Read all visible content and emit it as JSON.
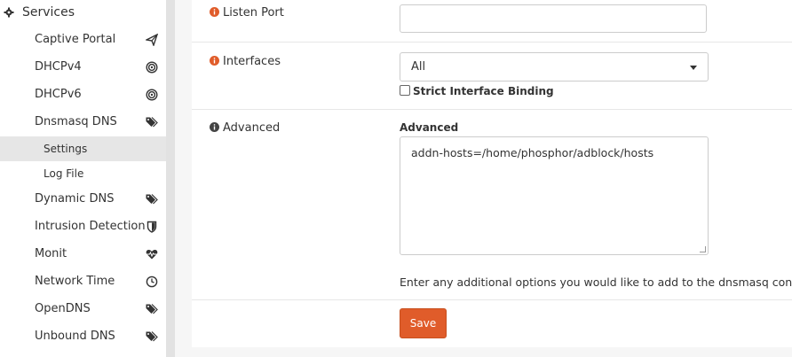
{
  "sidebar": {
    "header_label": "Services",
    "items": [
      {
        "label": "Captive Portal",
        "icon": "paper-plane-icon"
      },
      {
        "label": "DHCPv4",
        "icon": "bullseye-icon"
      },
      {
        "label": "DHCPv6",
        "icon": "bullseye-icon"
      },
      {
        "label": "Dnsmasq DNS",
        "icon": "tags-icon"
      },
      {
        "label": "Dynamic DNS",
        "icon": "tags-icon"
      },
      {
        "label": "Intrusion Detection",
        "icon": "shield-icon"
      },
      {
        "label": "Monit",
        "icon": "heartbeat-icon"
      },
      {
        "label": "Network Time",
        "icon": "clock-icon"
      },
      {
        "label": "OpenDNS",
        "icon": "tags-icon"
      },
      {
        "label": "Unbound DNS",
        "icon": "tags-icon"
      }
    ],
    "subitems": [
      {
        "label": "Settings",
        "active": true
      },
      {
        "label": "Log File",
        "active": false
      }
    ]
  },
  "form": {
    "listen_port": {
      "label": "Listen Port",
      "value": ""
    },
    "interfaces": {
      "label": "Interfaces",
      "selected": "All",
      "strict_label": "Strict Interface Binding",
      "strict_checked": false
    },
    "advanced": {
      "label": "Advanced",
      "field_title": "Advanced",
      "value": "addn-hosts=/home/phosphor/adblock/hosts",
      "help": "Enter any additional options you would like to add to the dnsmasq configura"
    },
    "save_label": "Save"
  },
  "colors": {
    "accent": "#e05c2a",
    "info_icon": "#e05c2a"
  }
}
